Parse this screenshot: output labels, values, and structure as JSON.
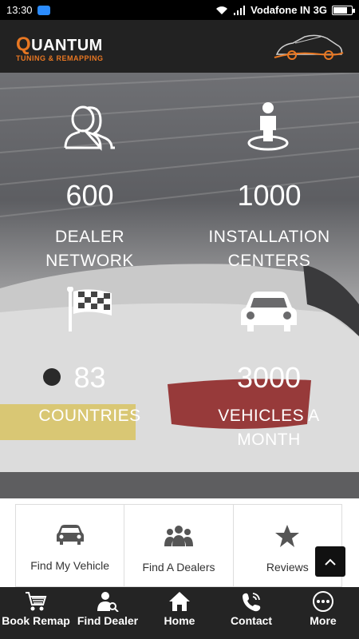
{
  "status_bar": {
    "time": "13:30",
    "carrier": "Vodafone IN 3G"
  },
  "header": {
    "brand_initial": "Q",
    "brand_rest": "UANTUM",
    "tagline": "TUNING & REMAPPING"
  },
  "stats": [
    {
      "value": "600",
      "label_line1": "DEALER",
      "label_line2": "NETWORK",
      "icon": "users-icon"
    },
    {
      "value": "1000",
      "label_line1": "INSTALLATION",
      "label_line2": "CENTERS",
      "icon": "location-person-icon"
    },
    {
      "value": "83",
      "label_line1": "COUNTRIES",
      "label_line2": "",
      "icon": "checkered-flag-icon"
    },
    {
      "value": "3000",
      "label_line1": "VEHICLES A",
      "label_line2": "MONTH",
      "icon": "car-icon"
    }
  ],
  "quick_links": [
    {
      "label": "Find My Vehicle",
      "icon": "car-icon"
    },
    {
      "label": "Find A Dealers",
      "icon": "group-icon"
    },
    {
      "label": "Reviews",
      "icon": "star-icon"
    }
  ],
  "bottom_nav": [
    {
      "label": "Book Remap",
      "icon": "cart-icon"
    },
    {
      "label": "Find Dealer",
      "icon": "user-search-icon"
    },
    {
      "label": "Home",
      "icon": "home-icon"
    },
    {
      "label": "Contact",
      "icon": "phone-icon"
    },
    {
      "label": "More",
      "icon": "more-icon"
    }
  ],
  "colors": {
    "accent": "#e87722",
    "header_bg": "#222222",
    "nav_bg": "#242424"
  }
}
